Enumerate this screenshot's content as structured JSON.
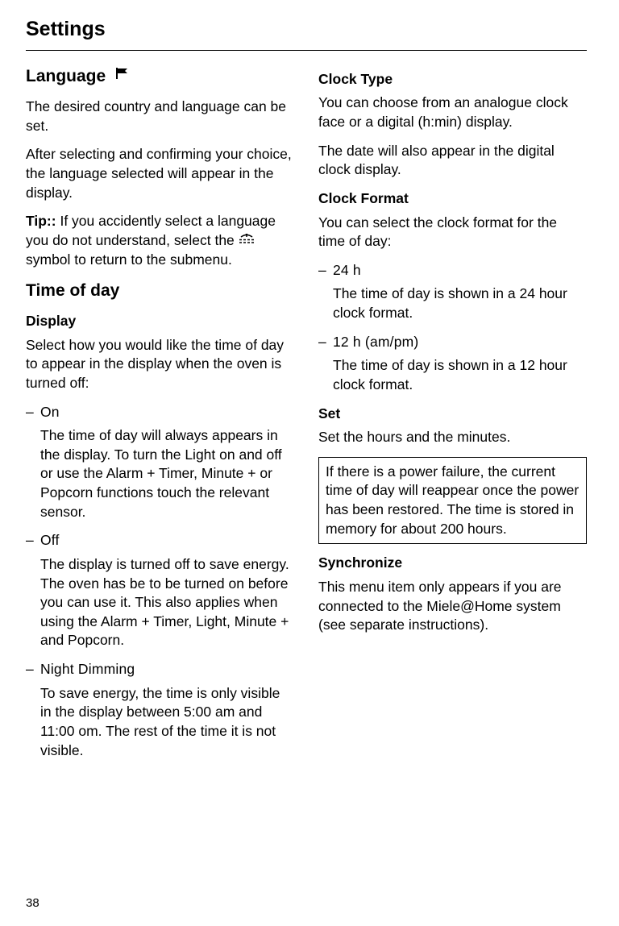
{
  "pageTitle": "Settings",
  "pageNumber": "38",
  "left": {
    "language": {
      "heading": "Language",
      "p1": "The desired country and language can be set.",
      "p2": "After selecting and confirming your choice, the language selected will appear in the display.",
      "tipLabel": "Tip::",
      "tipBefore": " If you accidently select a language you do not understand, select the ",
      "tipAfter": " symbol to return to the submenu."
    },
    "timeOfDay": {
      "heading": "Time of day",
      "display": {
        "heading": "Display",
        "intro": "Select how you would like the time of day to appear in the display when the oven is turned off:",
        "items": [
          {
            "label": "On",
            "desc": "The time of day will always appears in the display. To turn the Light on and off or use the Alarm + Timer, Minute + or Popcorn functions touch the relevant sensor."
          },
          {
            "label": "Off",
            "desc": "The display is turned off to save energy. The oven has be to be turned on before you can use it. This also applies when using the Alarm + Timer, Light, Minute + and Popcorn."
          },
          {
            "label": "Night Dimming",
            "desc": "To save energy, the time is only visible in the display between 5:00 am and 11:00 om. The rest of the time it is not visible."
          }
        ]
      }
    }
  },
  "right": {
    "clockType": {
      "heading": "Clock Type",
      "p1": "You can choose from an analogue clock face or a digital (h:min) display.",
      "p2": "The date will also appear in the digital clock display."
    },
    "clockFormat": {
      "heading": "Clock Format",
      "intro": "You can select the clock format for the time of day:",
      "items": [
        {
          "label": "24 h",
          "desc": "The time of day is shown in a 24 hour clock format."
        },
        {
          "label": "12 h (am/pm)",
          "desc": "The time of day is shown in a 12 hour clock format."
        }
      ]
    },
    "set": {
      "heading": "Set",
      "p1": "Set the hours and the minutes.",
      "note": "If there is a power failure, the current time of day will reappear once the power has been restored. The time is stored in memory for about 200 hours."
    },
    "sync": {
      "heading": "Synchronize",
      "p1": "This menu item only appears if you are connected to the Miele@Home system (see separate instructions)."
    }
  }
}
